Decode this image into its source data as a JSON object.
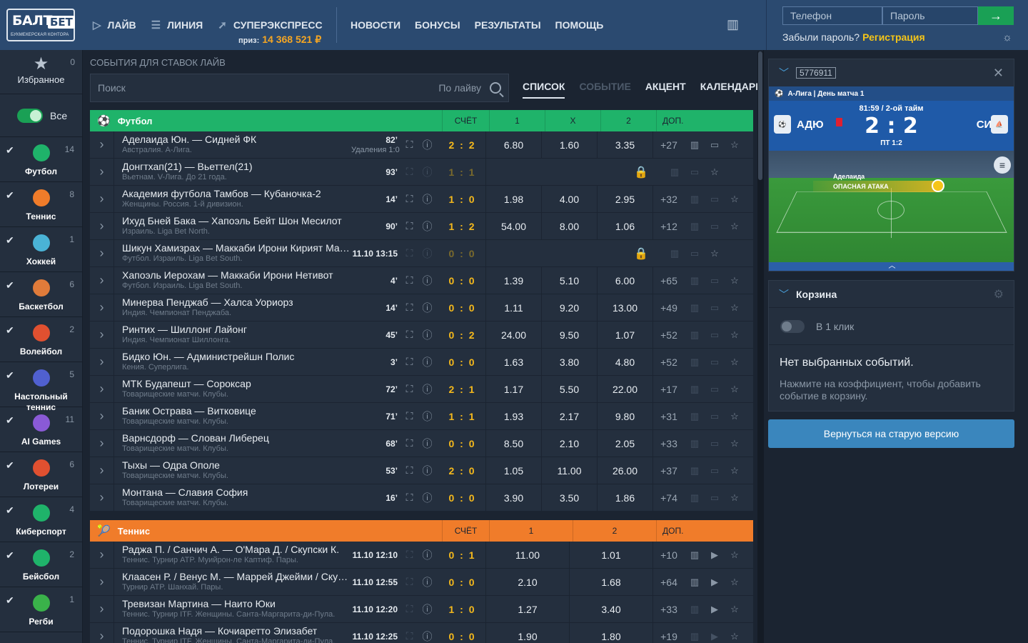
{
  "header": {
    "logo_main": "БАЛТ",
    "logo_bet": "БЕТ",
    "logo_sub": "БУКМЕКЕРСКАЯ КОНТОРА",
    "nav": [
      {
        "label": "ЛАЙВ",
        "icon": "play-icon"
      },
      {
        "label": "ЛИНИЯ",
        "icon": "list-icon"
      },
      {
        "label": "СУПЕРЭКСПРЕСС",
        "icon": "rocket-icon"
      }
    ],
    "prize_label": "приз:",
    "prize_value": "14 368 521 ₽",
    "nav2": [
      "НОВОСТИ",
      "БОНУСЫ",
      "РЕЗУЛЬТАТЫ",
      "ПОМОЩЬ"
    ],
    "phone_placeholder": "Телефон",
    "password_placeholder": "Пароль",
    "forgot": "Забыли пароль?",
    "register": "Регистрация"
  },
  "sidebar": {
    "favorites": {
      "label": "Избранное",
      "count": "0"
    },
    "all_label": "Все",
    "sports": [
      {
        "label": "Футбол",
        "count": "14",
        "color": "#1fb36a"
      },
      {
        "label": "Теннис",
        "count": "8",
        "color": "#f07c2a"
      },
      {
        "label": "Хоккей",
        "count": "1",
        "color": "#4ab3d6"
      },
      {
        "label": "Баскетбол",
        "count": "6",
        "color": "#e07b3a"
      },
      {
        "label": "Волейбол",
        "count": "2",
        "color": "#e05030"
      },
      {
        "label": "Настольный теннис",
        "count": "5",
        "color": "#5060d0"
      },
      {
        "label": "AI Games",
        "count": "11",
        "color": "#8a5ad6"
      },
      {
        "label": "Лотереи",
        "count": "6",
        "color": "#e05030"
      },
      {
        "label": "Киберспорт",
        "count": "4",
        "color": "#1fb36a"
      },
      {
        "label": "Бейсбол",
        "count": "2",
        "color": "#1fb36a"
      },
      {
        "label": "Регби",
        "count": "1",
        "color": "#3ab24a"
      }
    ]
  },
  "main": {
    "title": "СОБЫТИЯ ДЛЯ СТАВОК ЛАЙВ",
    "search_placeholder": "Поиск",
    "search_scope": "По лайву",
    "view_tabs": [
      "СПИСОК",
      "СОБЫТИЕ",
      "АКЦЕНТ",
      "КАЛЕНДАРЬ"
    ],
    "football": {
      "title": "Футбол",
      "cols": [
        "СЧЁТ",
        "1",
        "X",
        "2",
        "ДОП."
      ],
      "rows": [
        {
          "teams": "Аделаида Юн. — Сидней ФК",
          "league": "Австралия. А-Лига.",
          "time": "82’",
          "note": "Удаления 1:0",
          "score": "2 : 2",
          "o1": "6.80",
          "ox": "1.60",
          "o2": "3.35",
          "more": "+27",
          "locked": false
        },
        {
          "teams": "Донгтхап(21) — Вьеттел(21)",
          "league": "Вьетнам. V-Лига. До 21 года.",
          "time": "93’",
          "note": "",
          "score": "1 : 1",
          "o1": "",
          "ox": "",
          "o2": "",
          "more": "",
          "locked": true
        },
        {
          "teams": "Академия футбола Тамбов — Кубаночка-2",
          "league": "Женщины. Россия. 1-й дивизион.",
          "time": "14’",
          "note": "",
          "score": "1 : 0",
          "o1": "1.98",
          "ox": "4.00",
          "o2": "2.95",
          "more": "+32",
          "locked": false
        },
        {
          "teams": "Ихуд Бней Бака — Хапоэль Бейт Шон Месилот",
          "league": "Израиль. Liga Bet North.",
          "time": "90’",
          "note": "",
          "score": "1 : 2",
          "o1": "54.00",
          "ox": "8.00",
          "o2": "1.06",
          "more": "+12",
          "locked": false
        },
        {
          "teams": "Шикун Хамизрах — Маккаби Ирони Кирият Ма…",
          "league": "Футбол. Израиль. Liga Bet South.",
          "time": "11.10 13:15",
          "note": "",
          "score": "0 : 0",
          "o1": "",
          "ox": "",
          "o2": "",
          "more": "",
          "locked": true
        },
        {
          "teams": "Хапоэль Иерохам — Маккаби Ирони Нетивот",
          "league": "Футбол. Израиль. Liga Bet South.",
          "time": "4’",
          "note": "",
          "score": "0 : 0",
          "o1": "1.39",
          "ox": "5.10",
          "o2": "6.00",
          "more": "+65",
          "locked": false
        },
        {
          "teams": "Минерва Пенджаб — Халса Уориорз",
          "league": "Индия. Чемпионат Пенджаба.",
          "time": "14’",
          "note": "",
          "score": "0 : 0",
          "o1": "1.11",
          "ox": "9.20",
          "o2": "13.00",
          "more": "+49",
          "locked": false
        },
        {
          "teams": "Ринтих — Шиллонг Лайонг",
          "league": "Индия. Чемпионат Шиллонга.",
          "time": "45’",
          "note": "",
          "score": "0 : 2",
          "o1": "24.00",
          "ox": "9.50",
          "o2": "1.07",
          "more": "+52",
          "locked": false
        },
        {
          "teams": "Бидко Юн. — Администрейшн Полис",
          "league": "Кения. Суперлига.",
          "time": "3’",
          "note": "",
          "score": "0 : 0",
          "o1": "1.63",
          "ox": "3.80",
          "o2": "4.80",
          "more": "+52",
          "locked": false
        },
        {
          "teams": "МТК Будапешт — Сороксар",
          "league": "Товарищеские матчи. Клубы.",
          "time": "72’",
          "note": "",
          "score": "2 : 1",
          "o1": "1.17",
          "ox": "5.50",
          "o2": "22.00",
          "more": "+17",
          "locked": false
        },
        {
          "teams": "Баник Острава — Витковице",
          "league": "Товарищеские матчи. Клубы.",
          "time": "71’",
          "note": "",
          "score": "1 : 1",
          "o1": "1.93",
          "ox": "2.17",
          "o2": "9.80",
          "more": "+31",
          "locked": false
        },
        {
          "teams": "Варнсдорф — Слован Либерец",
          "league": "Товарищеские матчи. Клубы.",
          "time": "68’",
          "note": "",
          "score": "0 : 0",
          "o1": "8.50",
          "ox": "2.10",
          "o2": "2.05",
          "more": "+33",
          "locked": false
        },
        {
          "teams": "Тыхы — Одра Ополе",
          "league": "Товарищеские матчи. Клубы.",
          "time": "53’",
          "note": "",
          "score": "2 : 0",
          "o1": "1.05",
          "ox": "11.00",
          "o2": "26.00",
          "more": "+37",
          "locked": false
        },
        {
          "teams": "Монтана — Славия София",
          "league": "Товарищеские матчи. Клубы.",
          "time": "16’",
          "note": "",
          "score": "0 : 0",
          "o1": "3.90",
          "ox": "3.50",
          "o2": "1.86",
          "more": "+74",
          "locked": false
        }
      ]
    },
    "tennis": {
      "title": "Теннис",
      "cols": [
        "СЧЁТ",
        "1",
        "2",
        "ДОП."
      ],
      "rows": [
        {
          "teams": "Раджа П. / Санчич А. — О'Мара Д. / Скупски К.",
          "league": "Теннис. Турнир ATP. Муийрон-ле Каптиф. Пары.",
          "time": "11.10 12:10",
          "score": "0 : 1",
          "o1": "11.00",
          "o2": "1.01",
          "more": "+10"
        },
        {
          "teams": "Клаасен Р. / Венус М. — Маррей Джейми / Скуп…",
          "league": "Турнир ATP. Шанхай. Пары.",
          "time": "11.10 12:55",
          "score": "0 : 0",
          "o1": "2.10",
          "o2": "1.68",
          "more": "+64"
        },
        {
          "teams": "Тревизан Мартина — Наито Юки",
          "league": "Теннис. Турнир ITF. Женщины. Санта-Маргарита-ди-Пула.",
          "time": "11.10 12:20",
          "score": "1 : 0",
          "o1": "1.27",
          "o2": "3.40",
          "more": "+33"
        },
        {
          "teams": "Подорошка Надя — Кочиаретто Элизабет",
          "league": "Теннис. Турнир ITF. Женщины. Санта-Маргарита-ди-Пула.",
          "time": "11.10 12:25",
          "score": "0 : 0",
          "o1": "1.90",
          "o2": "1.80",
          "more": "+19"
        }
      ]
    }
  },
  "match_widget": {
    "event_id": "5776911",
    "league": "А-Лига | День матча 1",
    "time_info": "81:59 / 2-ой тайм",
    "score": "2 : 2",
    "half_time": "ПТ 1:2",
    "team1": "АДЮ",
    "team2": "СИД",
    "attack_team": "Аделаида",
    "attack_label": "ОПАСНАЯ АТАКА"
  },
  "cart": {
    "title": "Корзина",
    "one_click": "В 1 клик",
    "empty_title": "Нет выбранных событий.",
    "empty_hint": "Нажмите на коэффициент, чтобы добавить событие в корзину.",
    "old_version": "Вернуться на старую версию"
  }
}
